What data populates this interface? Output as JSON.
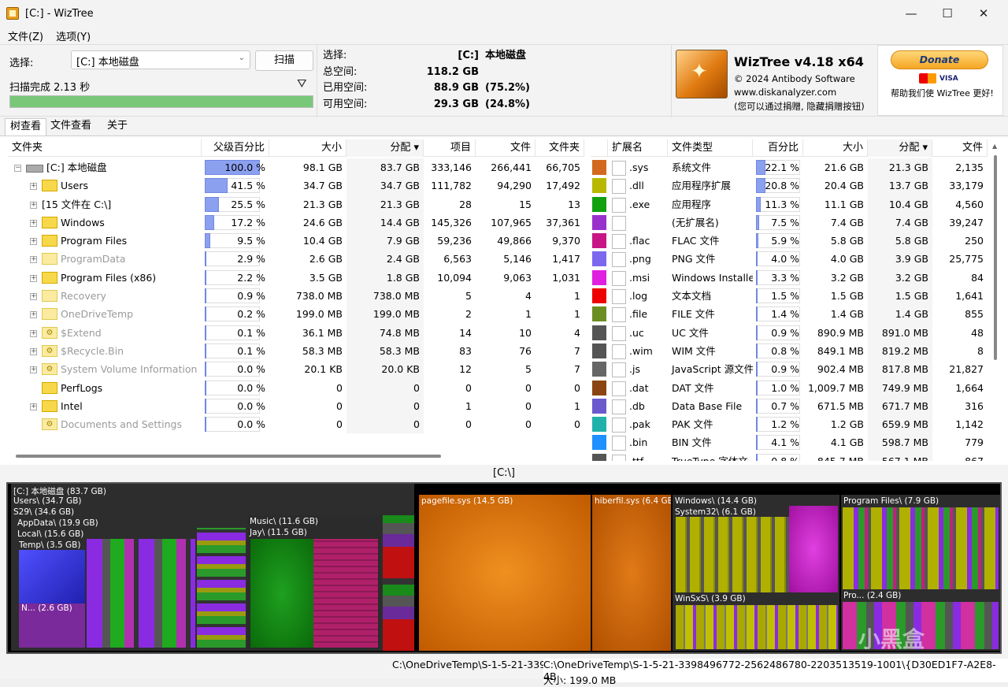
{
  "window": {
    "title": "[C:]  - WizTree",
    "min": "—",
    "max": "☐",
    "close": "✕"
  },
  "menu": [
    "文件(Z)",
    "选项(Y)"
  ],
  "scan": {
    "select_label": "选择:",
    "drive_value": "[C:] 本地磁盘",
    "scan_button": "扫描",
    "status": "扫描完成 2.13 秒",
    "progress": 1.0
  },
  "info": {
    "select_k": "选择:",
    "select_v": "[C:]",
    "select_p": "本地磁盘",
    "total_k": "总空间:",
    "total_v": "118.2 GB",
    "used_k": "已用空间:",
    "used_v": "88.9 GB",
    "used_p": "(75.2%)",
    "free_k": "可用空间:",
    "free_v": "29.3 GB",
    "free_p": "(24.8%)"
  },
  "brand": {
    "name": "WizTree v4.18 x64",
    "copyright": "© 2024 Antibody Software",
    "website": "www.diskanalyzer.com",
    "hint": "(您可以通过捐赠, 隐藏捐赠按钮)"
  },
  "donate": {
    "button": "Donate",
    "mc": "MasterCard",
    "visa": "VISA",
    "text": "帮助我们使 WizTree 更好!"
  },
  "tabs": [
    "树查看",
    "文件查看",
    "关于"
  ],
  "tree": {
    "headers": [
      "文件夹",
      "父级百分比",
      "大小",
      "分配 ▾",
      "项目",
      "文件",
      "文件夹"
    ],
    "rows": [
      {
        "name": "[C:] 本地磁盘",
        "pct": "100.0 %",
        "p": 1.0,
        "size": "98.1 GB",
        "alloc": "83.7 GB",
        "items": "333,146",
        "files": "266,441",
        "folders": "66,705",
        "icon": "drive",
        "dim": false,
        "exp": "⊟"
      },
      {
        "name": "Users",
        "pct": "41.5 %",
        "p": 0.415,
        "size": "34.7 GB",
        "alloc": "34.7 GB",
        "items": "111,782",
        "files": "94,290",
        "folders": "17,492",
        "icon": "folder",
        "dim": false,
        "exp": "+"
      },
      {
        "name": "[15 文件在 C:\\]",
        "pct": "25.5 %",
        "p": 0.255,
        "size": "21.3 GB",
        "alloc": "21.3 GB",
        "items": "28",
        "files": "15",
        "folders": "13",
        "icon": "none",
        "dim": false,
        "exp": "+"
      },
      {
        "name": "Windows",
        "pct": "17.2 %",
        "p": 0.172,
        "size": "24.6 GB",
        "alloc": "14.4 GB",
        "items": "145,326",
        "files": "107,965",
        "folders": "37,361",
        "icon": "folder",
        "dim": false,
        "exp": "+"
      },
      {
        "name": "Program Files",
        "pct": "9.5 %",
        "p": 0.095,
        "size": "10.4 GB",
        "alloc": "7.9 GB",
        "items": "59,236",
        "files": "49,866",
        "folders": "9,370",
        "icon": "folder",
        "dim": false,
        "exp": "+"
      },
      {
        "name": "ProgramData",
        "pct": "2.9 %",
        "p": 0.029,
        "size": "2.6 GB",
        "alloc": "2.4 GB",
        "items": "6,563",
        "files": "5,146",
        "folders": "1,417",
        "icon": "folder",
        "dim": true,
        "exp": "+"
      },
      {
        "name": "Program Files (x86)",
        "pct": "2.2 %",
        "p": 0.022,
        "size": "3.5 GB",
        "alloc": "1.8 GB",
        "items": "10,094",
        "files": "9,063",
        "folders": "1,031",
        "icon": "folder",
        "dim": false,
        "exp": "+"
      },
      {
        "name": "Recovery",
        "pct": "0.9 %",
        "p": 0.009,
        "size": "738.0 MB",
        "alloc": "738.0 MB",
        "items": "5",
        "files": "4",
        "folders": "1",
        "icon": "folder",
        "dim": true,
        "exp": "+"
      },
      {
        "name": "OneDriveTemp",
        "pct": "0.2 %",
        "p": 0.002,
        "size": "199.0 MB",
        "alloc": "199.0 MB",
        "items": "2",
        "files": "1",
        "folders": "1",
        "icon": "folder",
        "dim": true,
        "exp": "+"
      },
      {
        "name": "$Extend",
        "pct": "0.1 %",
        "p": 0.001,
        "size": "36.1 MB",
        "alloc": "74.8 MB",
        "items": "14",
        "files": "10",
        "folders": "4",
        "icon": "gear",
        "dim": true,
        "exp": "+"
      },
      {
        "name": "$Recycle.Bin",
        "pct": "0.1 %",
        "p": 0.001,
        "size": "58.3 MB",
        "alloc": "58.3 MB",
        "items": "83",
        "files": "76",
        "folders": "7",
        "icon": "gear",
        "dim": true,
        "exp": "+"
      },
      {
        "name": "System Volume Information",
        "pct": "0.0 %",
        "p": 0,
        "size": "20.1 KB",
        "alloc": "20.0 KB",
        "items": "12",
        "files": "5",
        "folders": "7",
        "icon": "gear",
        "dim": true,
        "exp": "+"
      },
      {
        "name": "PerfLogs",
        "pct": "0.0 %",
        "p": 0,
        "size": "0",
        "alloc": "0",
        "items": "0",
        "files": "0",
        "folders": "0",
        "icon": "folder",
        "dim": false,
        "exp": ""
      },
      {
        "name": "Intel",
        "pct": "0.0 %",
        "p": 0,
        "size": "0",
        "alloc": "0",
        "items": "1",
        "files": "0",
        "folders": "1",
        "icon": "folder",
        "dim": false,
        "exp": "+"
      },
      {
        "name": "Documents and Settings",
        "pct": "0.0 %",
        "p": 0,
        "size": "0",
        "alloc": "0",
        "items": "0",
        "files": "0",
        "folders": "0",
        "icon": "gear",
        "dim": true,
        "exp": ""
      }
    ]
  },
  "ext": {
    "headers": [
      "扩展名",
      "文件类型",
      "百分比",
      "大小",
      "分配 ▾",
      "文件"
    ],
    "rows": [
      {
        "color": "#d2691e",
        "ext": ".sys",
        "type": "系统文件",
        "pct": "22.1 %",
        "p": 0.221,
        "size": "21.6 GB",
        "alloc": "21.3 GB",
        "files": "2,135"
      },
      {
        "color": "#b8b800",
        "ext": ".dll",
        "type": "应用程序扩展",
        "pct": "20.8 %",
        "p": 0.208,
        "size": "20.4 GB",
        "alloc": "13.7 GB",
        "files": "33,179"
      },
      {
        "color": "#10a010",
        "ext": ".exe",
        "type": "应用程序",
        "pct": "11.3 %",
        "p": 0.113,
        "size": "11.1 GB",
        "alloc": "10.4 GB",
        "files": "4,560"
      },
      {
        "color": "#9932cc",
        "ext": "",
        "type": "(无扩展名)",
        "pct": "7.5 %",
        "p": 0.075,
        "size": "7.4 GB",
        "alloc": "7.4 GB",
        "files": "39,247"
      },
      {
        "color": "#c71585",
        "ext": ".flac",
        "type": "FLAC 文件",
        "pct": "5.9 %",
        "p": 0.059,
        "size": "5.8 GB",
        "alloc": "5.8 GB",
        "files": "250"
      },
      {
        "color": "#7b68ee",
        "ext": ".png",
        "type": "PNG 文件",
        "pct": "4.0 %",
        "p": 0.04,
        "size": "4.0 GB",
        "alloc": "3.9 GB",
        "files": "25,775"
      },
      {
        "color": "#e020e0",
        "ext": ".msi",
        "type": "Windows Installe",
        "pct": "3.3 %",
        "p": 0.033,
        "size": "3.2 GB",
        "alloc": "3.2 GB",
        "files": "84"
      },
      {
        "color": "#ee0000",
        "ext": ".log",
        "type": "文本文档",
        "pct": "1.5 %",
        "p": 0.015,
        "size": "1.5 GB",
        "alloc": "1.5 GB",
        "files": "1,641"
      },
      {
        "color": "#6b8e23",
        "ext": ".file",
        "type": "FILE 文件",
        "pct": "1.4 %",
        "p": 0.014,
        "size": "1.4 GB",
        "alloc": "1.4 GB",
        "files": "855"
      },
      {
        "color": "#555555",
        "ext": ".uc",
        "type": "UC 文件",
        "pct": "0.9 %",
        "p": 0.009,
        "size": "890.9 MB",
        "alloc": "891.0 MB",
        "files": "48"
      },
      {
        "color": "#555555",
        "ext": ".wim",
        "type": "WIM 文件",
        "pct": "0.8 %",
        "p": 0.008,
        "size": "849.1 MB",
        "alloc": "819.2 MB",
        "files": "8"
      },
      {
        "color": "#666666",
        "ext": ".js",
        "type": "JavaScript 源文件",
        "pct": "0.9 %",
        "p": 0.009,
        "size": "902.4 MB",
        "alloc": "817.8 MB",
        "files": "21,827"
      },
      {
        "color": "#8b4513",
        "ext": ".dat",
        "type": "DAT 文件",
        "pct": "1.0 %",
        "p": 0.01,
        "size": "1,009.7 MB",
        "alloc": "749.9 MB",
        "files": "1,664"
      },
      {
        "color": "#6a5acd",
        "ext": ".db",
        "type": "Data Base File",
        "pct": "0.7 %",
        "p": 0.007,
        "size": "671.5 MB",
        "alloc": "671.7 MB",
        "files": "316"
      },
      {
        "color": "#20b2aa",
        "ext": ".pak",
        "type": "PAK 文件",
        "pct": "1.2 %",
        "p": 0.012,
        "size": "1.2 GB",
        "alloc": "659.9 MB",
        "files": "1,142"
      },
      {
        "color": "#1e90ff",
        "ext": ".bin",
        "type": "BIN 文件",
        "pct": "4.1 %",
        "p": 0.041,
        "size": "4.1 GB",
        "alloc": "598.7 MB",
        "files": "779"
      },
      {
        "color": "#555555",
        "ext": ".ttf",
        "type": "TrueType 字体文",
        "pct": "0.8 %",
        "p": 0.008,
        "size": "845.7 MB",
        "alloc": "567.1 MB",
        "files": "867"
      }
    ]
  },
  "path": "[C:\\]",
  "treemap": {
    "root": "[C:] 本地磁盘  (83.7 GB)",
    "labels": {
      "users": "Users\\ (34.7 GB)",
      "s29": "S29\\ (34.6 GB)",
      "appdata": "AppData\\ (19.9 GB)",
      "local": "Local\\ (15.6 GB)",
      "temp": "Temp\\ (3.5 GB)",
      "n": "N... (2.6 GB)",
      "music": "Music\\ (11.6 GB)",
      "jay": "Jay\\ (11.5 GB)",
      "pagefile": "pagefile.sys (14.5 GB)",
      "hiberfil": "hiberfil.sys (6.4 GB)",
      "windows": "Windows\\ (14.4 GB)",
      "system32": "System32\\ (6.1 GB)",
      "winsxs": "WinSxS\\ (3.9 GB)",
      "progfiles": "Program Files\\ (7.9 GB)",
      "pro": "Pro... (2.4 GB)"
    }
  },
  "footer": {
    "a": "C:\\OneDriveTemp\\S-1-5-21-3398",
    "b": "C:\\OneDriveTemp\\S-1-5-21-3398496772-2562486780-2203513519-1001\\{D30ED1F7-A2E8-4B",
    "c": "大小: 199.0 MB"
  },
  "watermark": "小黑盒"
}
